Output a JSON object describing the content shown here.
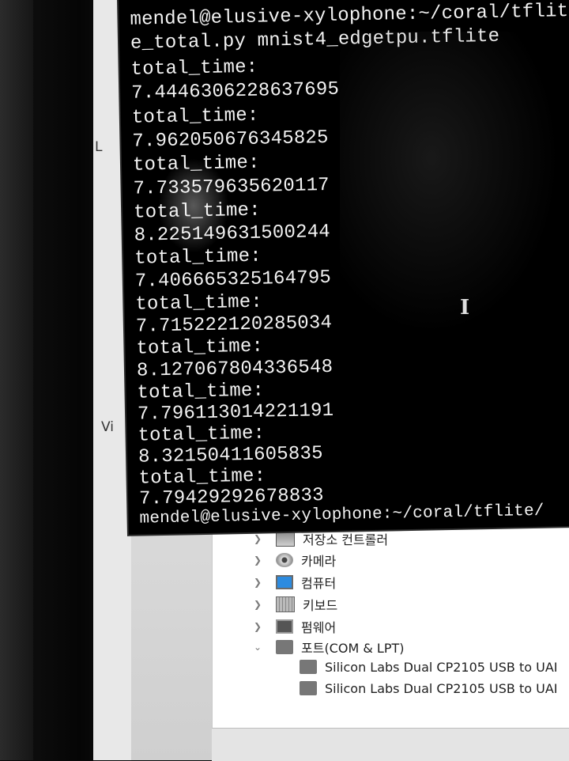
{
  "terminal": {
    "lines": [
      "mendel@elusive-xylophone:~/coral/tflit",
      "e_total.py mnist4_edgetpu.tflite",
      "total_time:",
      "7.4446306228637695",
      "total_time:",
      "7.962050676345825",
      "total_time:",
      "7.733579635620117",
      "total_time:",
      "8.225149631500244",
      "total_time:",
      "7.406665325164795",
      "total_time:",
      "7.715222120285034",
      "total_time:",
      "8.127067804336548",
      "total_time:",
      "7.796113014221191",
      "total_time:",
      "8.32150411605835",
      "total_time:",
      "7.79429292678833",
      "mendel@elusive-xylophone:~/coral/tflite/"
    ]
  },
  "left_strip": {
    "l": "L",
    "vi": "Vi"
  },
  "device_manager": {
    "items": [
      {
        "label": "저장소 컨트롤러",
        "icon": "storage-controller-icon",
        "expanded": false
      },
      {
        "label": "카메라",
        "icon": "camera-icon",
        "expanded": false
      },
      {
        "label": "컴퓨터",
        "icon": "computer-icon",
        "expanded": false
      },
      {
        "label": "키보드",
        "icon": "keyboard-icon",
        "expanded": false
      },
      {
        "label": "펌웨어",
        "icon": "firmware-icon",
        "expanded": false
      },
      {
        "label": "포트(COM & LPT)",
        "icon": "port-icon",
        "expanded": true
      }
    ],
    "children": [
      {
        "label": "Silicon Labs Dual CP2105 USB to UAI"
      },
      {
        "label": "Silicon Labs Dual CP2105 USB to UAI"
      }
    ]
  }
}
